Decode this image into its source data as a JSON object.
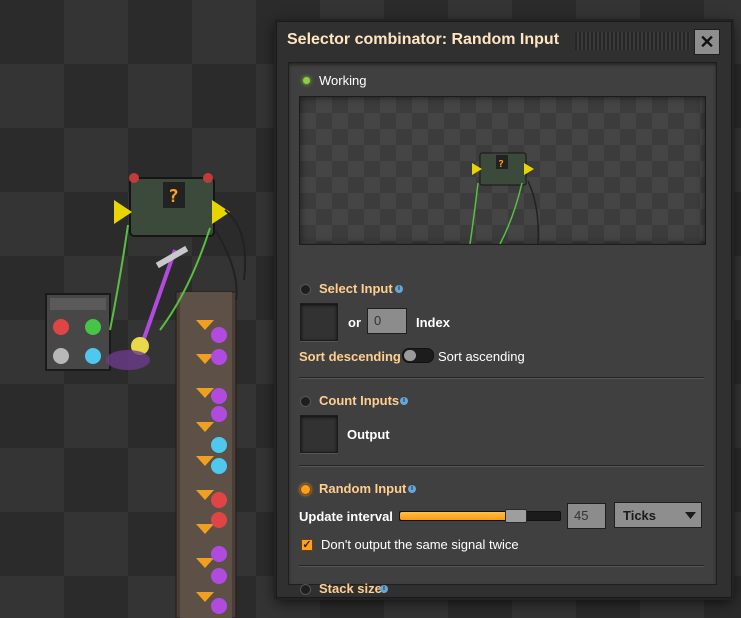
{
  "window": {
    "title": "Selector combinator: Random Input",
    "close_glyph": "✕"
  },
  "status": {
    "text": "Working",
    "led_color": "#8bd13f"
  },
  "select_input": {
    "label": "Select Input",
    "or_label": "or",
    "index_value": "0",
    "index_label": "Index",
    "sort_descending": "Sort descending",
    "sort_ascending": "Sort ascending"
  },
  "count_inputs": {
    "label": "Count Inputs",
    "output_label": "Output"
  },
  "random_input": {
    "label": "Random Input",
    "selected": true,
    "update_interval_label": "Update interval",
    "slider_fraction": 0.72,
    "interval_value": "45",
    "unit_selected": "Ticks",
    "no_repeat_label": "Don't output the same signal twice",
    "no_repeat_checked": true
  },
  "stack_size": {
    "label": "Stack size"
  },
  "info_glyph": "i",
  "colors": {
    "accent": "#ff9f1b",
    "label_orange": "#ffcf8f",
    "title": "#ffe6c0",
    "info": "#68a6d6"
  }
}
